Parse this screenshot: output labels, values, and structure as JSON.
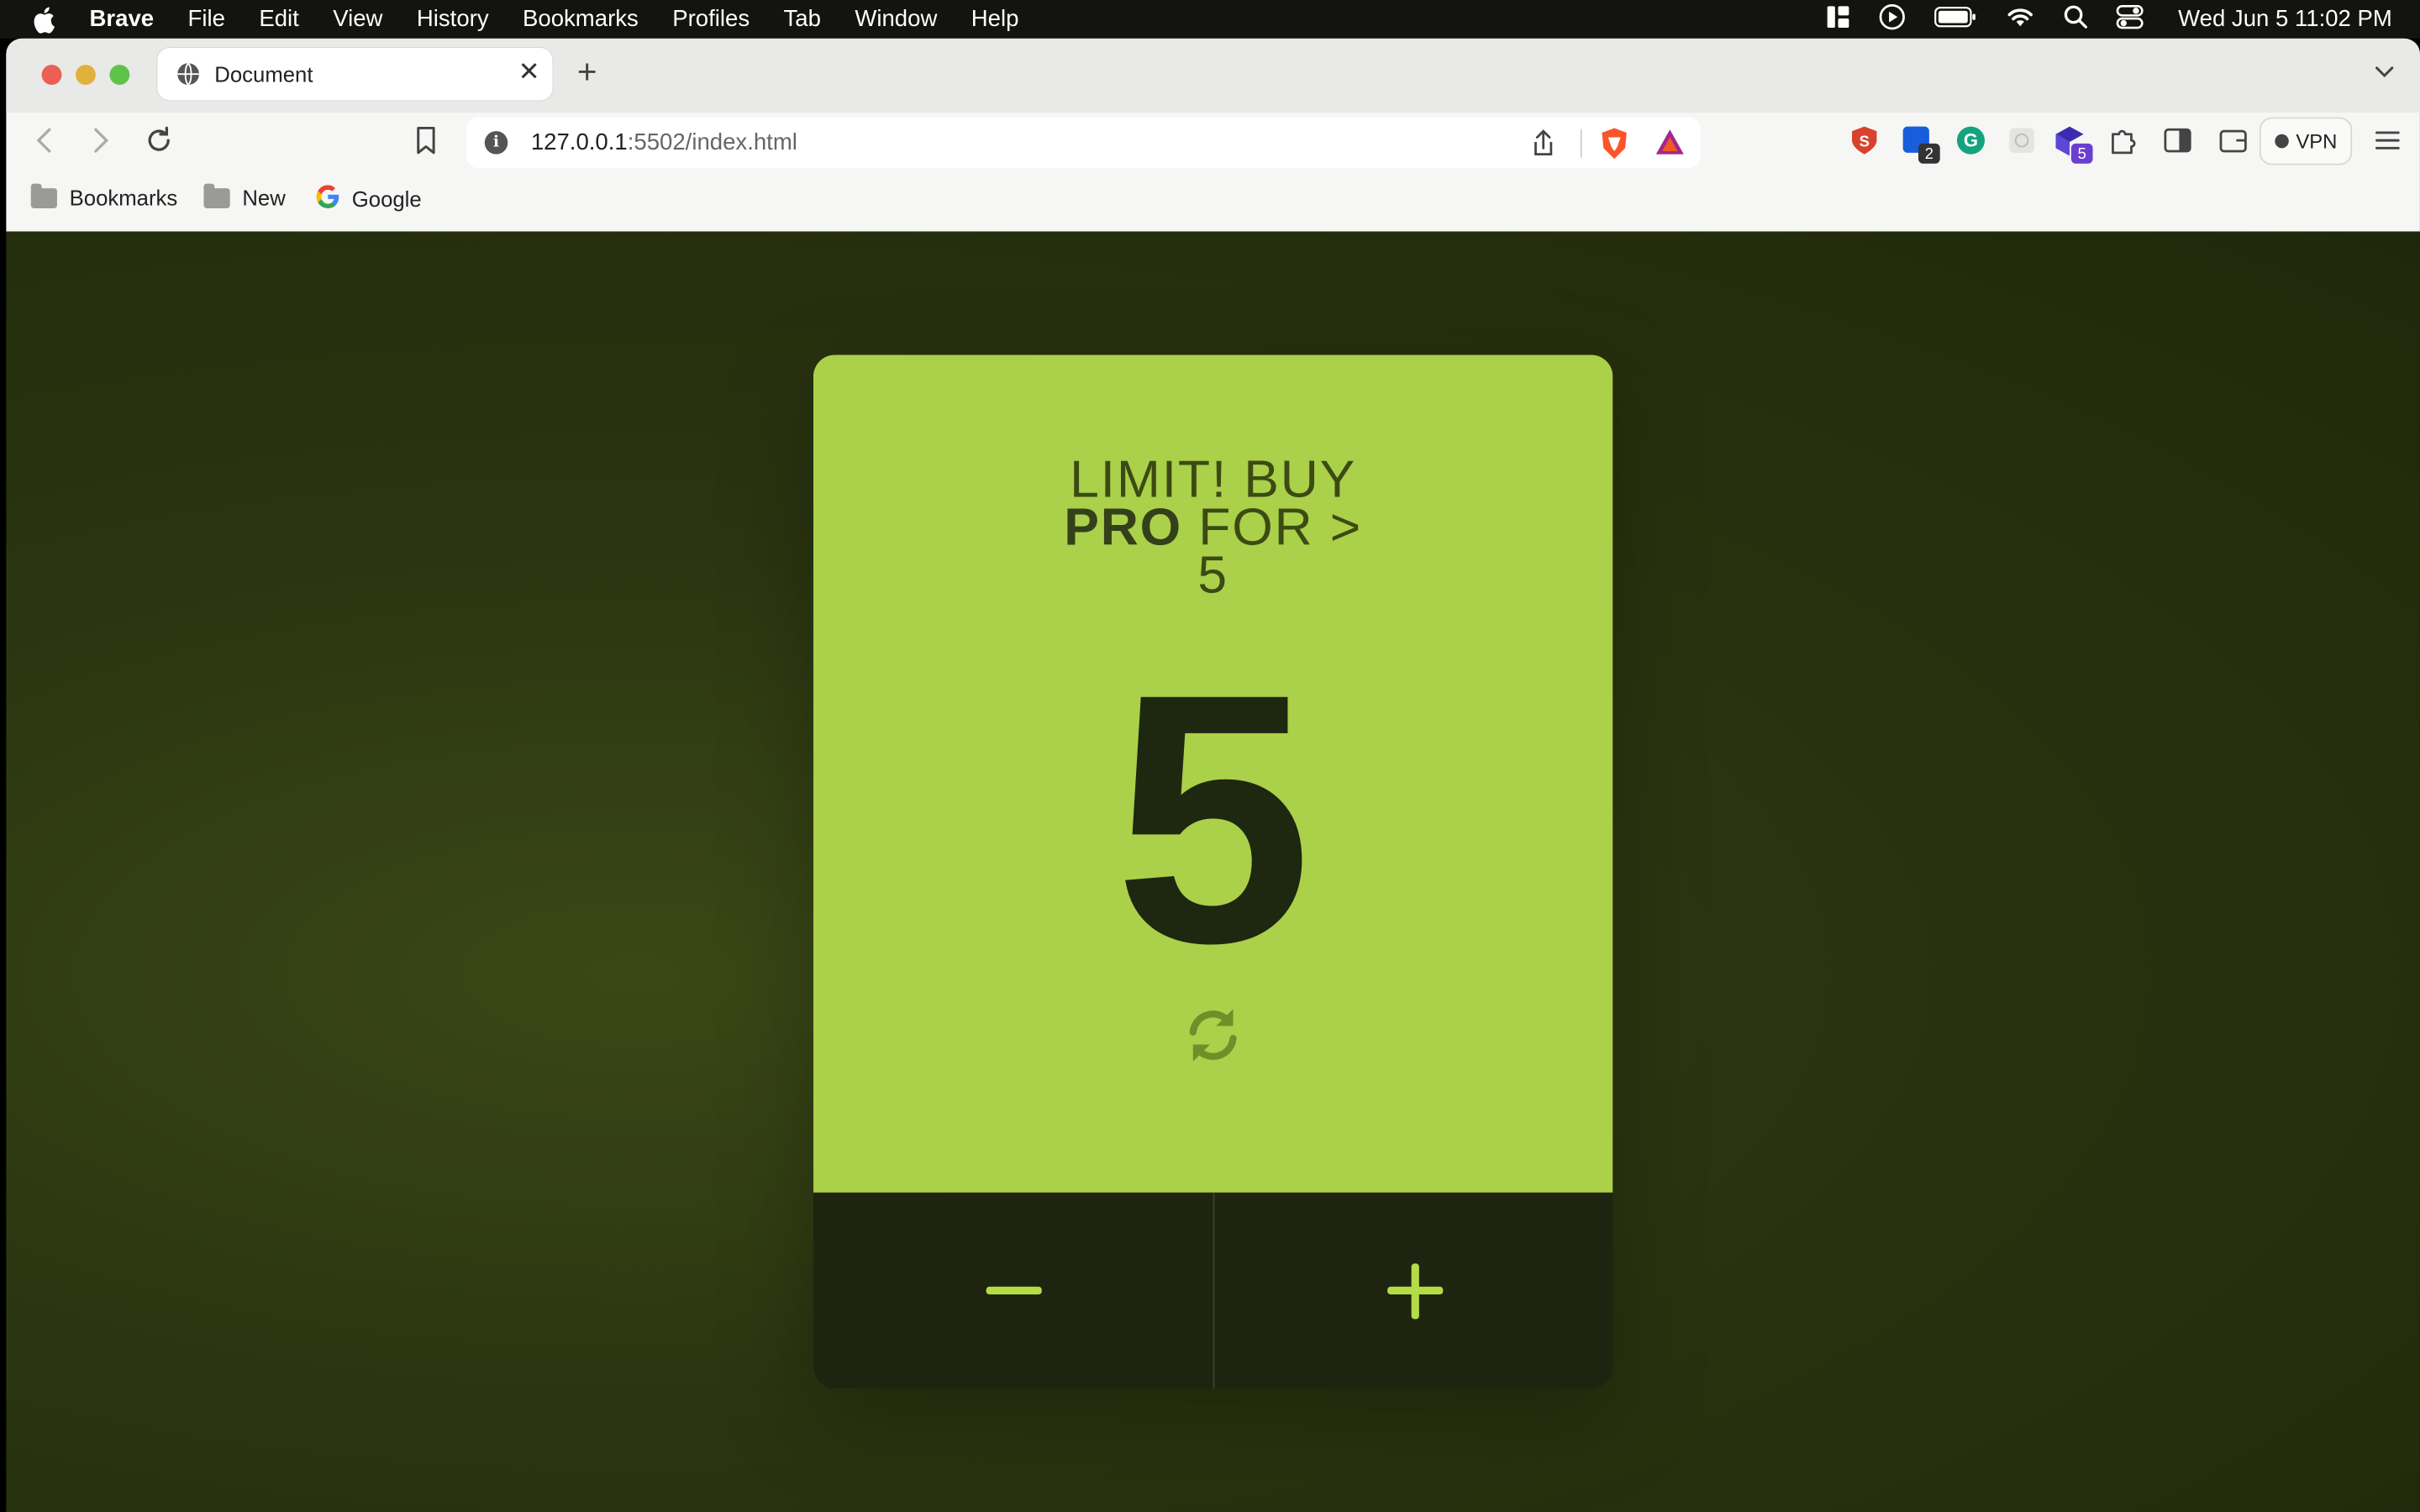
{
  "menubar": {
    "app": "Brave",
    "items": [
      "File",
      "Edit",
      "View",
      "History",
      "Bookmarks",
      "Profiles",
      "Tab",
      "Window",
      "Help"
    ],
    "clock": "Wed Jun 5  11:02 PM"
  },
  "browser": {
    "tab_title": "Document",
    "url_host": "127.0.0.1",
    "url_rest": ":5502/index.html",
    "vpn_label": "VPN",
    "ext_badges": [
      "2",
      "5"
    ]
  },
  "bookmarks": [
    {
      "label": "Bookmarks",
      "icon": "folder-icon"
    },
    {
      "label": "New",
      "icon": "folder-icon"
    },
    {
      "label": "Google",
      "icon": "google-icon"
    }
  ],
  "counter": {
    "limit_line1": "LIMIT! BUY",
    "limit_pro": "PRO",
    "limit_line2_rest": " FOR >",
    "limit_line3": "5",
    "value": "5",
    "decrement_icon": "minus-icon",
    "increment_icon": "plus-icon",
    "reset_icon": "refresh-icon"
  },
  "colors": {
    "card_top": "#abd04a",
    "card_bottom": "#1f2410",
    "accent": "#b3dc47",
    "page_bg": "#2b3510"
  }
}
